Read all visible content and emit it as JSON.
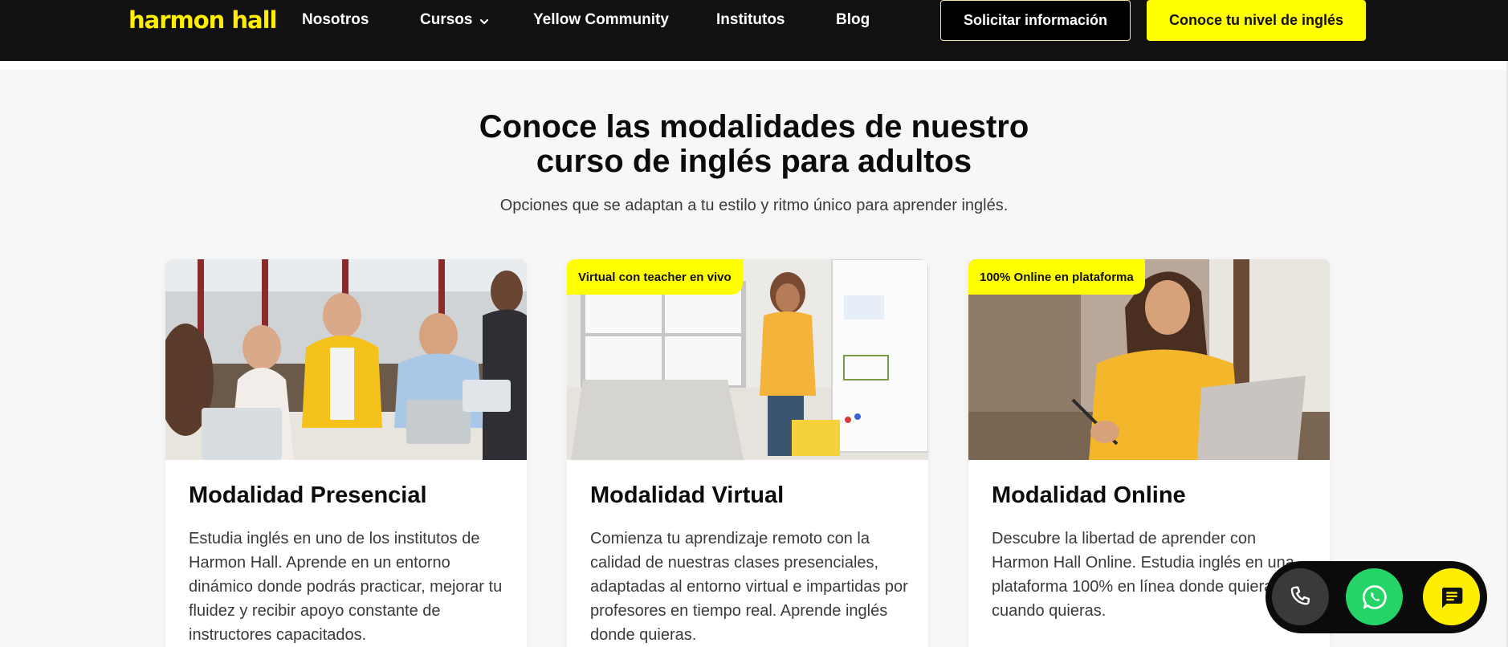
{
  "header": {
    "logo": "harmon hall",
    "nav": [
      {
        "label": "Nosotros"
      },
      {
        "label": "Cursos"
      },
      {
        "label": "Yellow Community"
      },
      {
        "label": "Institutos"
      },
      {
        "label": "Blog"
      }
    ],
    "cta_outline": "Solicitar información",
    "cta_primary": "Conoce tu nivel de inglés"
  },
  "section": {
    "title_line1": "Conoce las modalidades de nuestro",
    "title_line2": "curso de inglés para adultos",
    "subtitle": "Opciones que se adaptan a tu estilo y ritmo único para aprender inglés."
  },
  "cards": [
    {
      "badge": "",
      "title": "Modalidad Presencial",
      "text": "Estudia inglés en uno de los institutos de Harmon Hall. Aprende en un entorno dinámico donde podrás practicar, mejorar tu fluidez y recibir apoyo constante de instructores capacitados."
    },
    {
      "badge": "Virtual con teacher en vivo",
      "title": "Modalidad Virtual",
      "text": "Comienza tu aprendizaje remoto con la calidad de nuestras clases presenciales, adaptadas al entorno virtual e impartidas por profesores en tiempo real. Aprende inglés donde quieras."
    },
    {
      "badge": "100% Online en plataforma",
      "title": "Modalidad Online",
      "text": "Descubre la libertad de aprender con Harmon Hall Online. Estudia inglés en una plataforma 100% en línea donde quieras y cuando quieras."
    }
  ],
  "contact": {
    "icons": [
      "phone-icon",
      "whatsapp-icon",
      "chat-icon"
    ]
  },
  "colors": {
    "brand_yellow": "#ffff00",
    "header_bg": "#111111",
    "whatsapp_green": "#25d366"
  }
}
